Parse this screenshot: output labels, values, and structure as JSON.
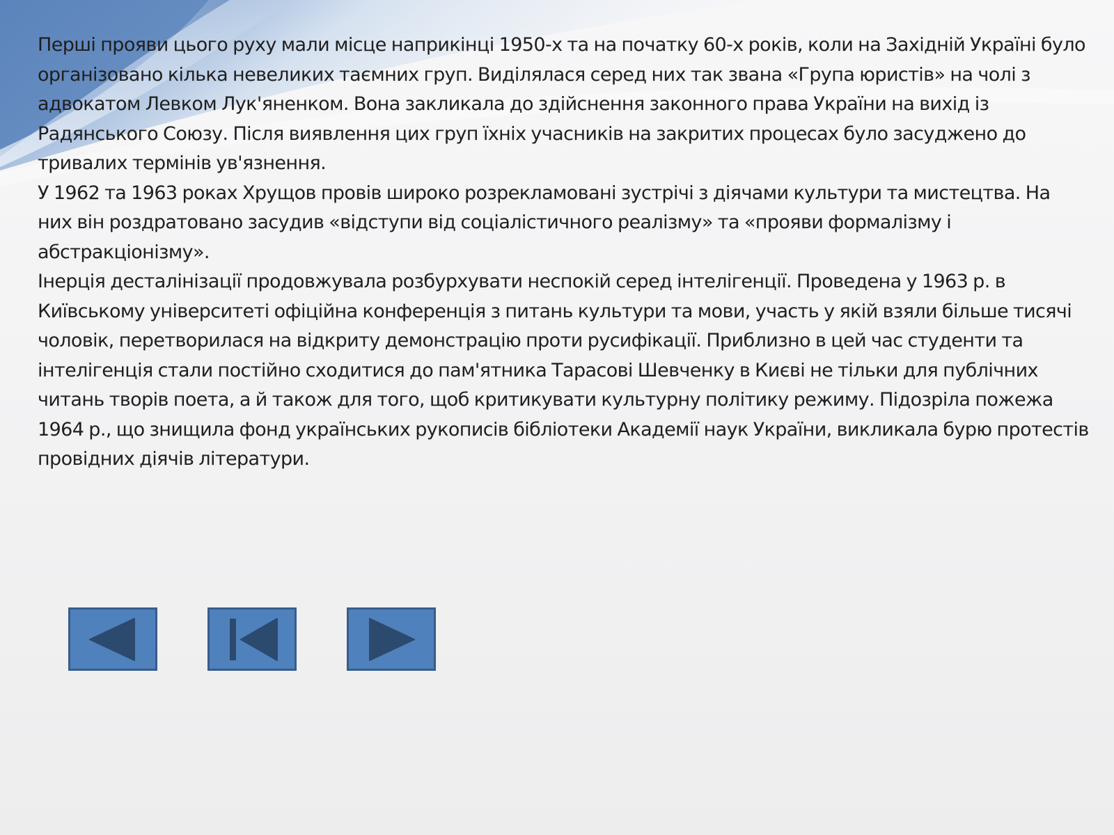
{
  "colors": {
    "button_fill": "#4f81bd",
    "button_border": "#385d8a",
    "icon_fill": "#2c4a6e",
    "text": "#1f1f1f"
  },
  "content": {
    "paragraphs": [
      "Перші прояви цього руху мали місце наприкінці 1950-х та на початку 60-х років, коли на Західній Україні було організовано кілька невеликих таємних груп. Виділялася серед них так звана «Група юристів» на чолі з адвокатом Левком Лук'яненком. Вона закликала до здійснення законного права України на вихід із Радянського Союзу. Після виявлення цих груп їхніх учасників на закритих процесах було засуджено до тривалих термінів ув'язнення.",
      "У 1962 та 1963 роках Хрущов провів широко розрекламовані зустрічі з діячами культури та мистецтва. На них він роздратовано засудив «відступи від соціалістичного реалізму» та «прояви формалізму і абстракціонізму».",
      "Інерція десталінізації продовжувала розбурхувати неспокій серед інтелігенції. Проведена у 1963 р. в Київському університеті офіційна конференція з питань культури та мови, участь у якій взяли більше тисячі чоловік, перетворилася на відкриту демонстрацію проти русифікації. Приблизно в цей час студенти та інтелігенція стали постійно сходитися до пам'ятника Тарасові Шевченку в Києві не тільки для публічних читань творів поета, а й також для того, щоб критикувати культурну політику режиму. Підозріла пожежа 1964 р., що знищила фонд українських рукописів бібліотеки Академії наук України, викликала бурю протестів провідних діячів літератури."
    ]
  },
  "navigation": {
    "buttons": [
      {
        "icon": "previous-triangle-icon"
      },
      {
        "icon": "first-slide-icon"
      },
      {
        "icon": "next-triangle-icon"
      }
    ]
  }
}
